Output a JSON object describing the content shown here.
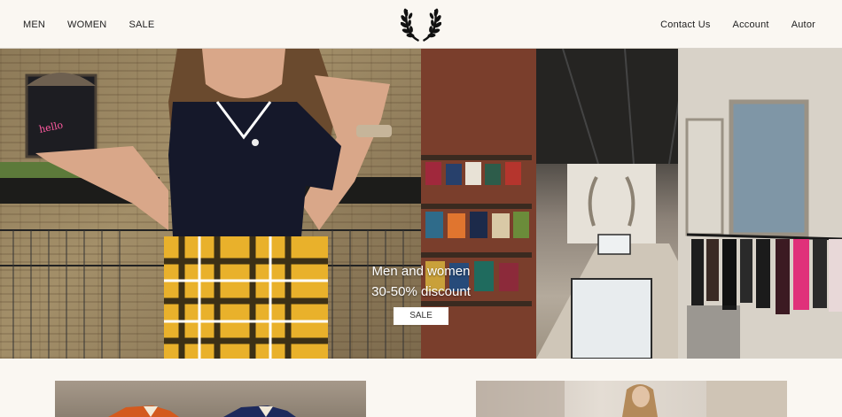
{
  "nav": {
    "left": [
      "MEN",
      "WOMEN",
      "SALE"
    ],
    "right": [
      "Contact Us",
      "Account",
      "Autor"
    ]
  },
  "hero": {
    "line1": "Men and women",
    "line2": "30-50% discount",
    "button": "SALE"
  },
  "icons": {
    "logo": "laurel-wreath-icon"
  },
  "colors": {
    "background": "#faf7f2",
    "button": "#ffffff",
    "text": "#222222"
  }
}
